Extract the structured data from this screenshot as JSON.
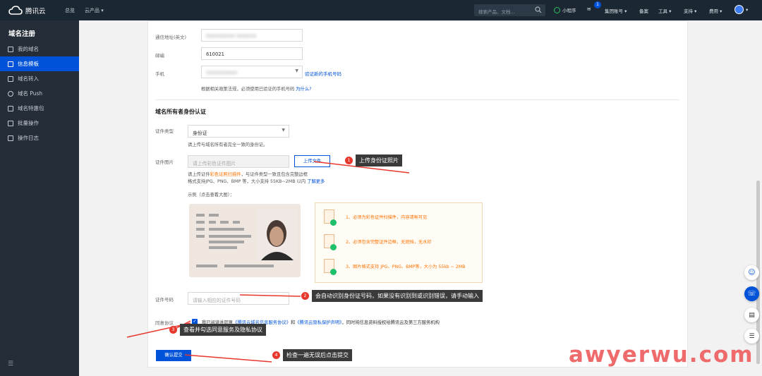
{
  "topbar": {
    "brand": "腾讯云",
    "nav_overview": "总览",
    "nav_products": "云产品",
    "search_placeholder": "搜索产品、文档...",
    "mini_program": "小程序",
    "message_badge": "1",
    "group_account": "集团账号",
    "filing": "备案",
    "tools": "工具",
    "support": "支持",
    "billing": "费用"
  },
  "sidebar": {
    "title": "域名注册",
    "items": [
      {
        "label": "我的域名"
      },
      {
        "label": "信息模板"
      },
      {
        "label": "域名转入"
      },
      {
        "label": "域名 Push"
      },
      {
        "label": "域名特惠包"
      },
      {
        "label": "批量操作"
      },
      {
        "label": "操作日志"
      }
    ]
  },
  "form": {
    "address_en_label": "通信地址(英文)",
    "address_en_value": "Xxxxxxxxxx xxxxxxx",
    "postcode_label": "邮编",
    "postcode_value": "610021",
    "phone_label": "手机",
    "phone_value": "1xxxxxxxxxx",
    "verify_phone_link": "验证新的手机号码",
    "phone_note": "根据相关政策法规，必须使用已验证的手机号码",
    "why_link": "为什么?",
    "section_title": "域名所有者身份认证",
    "id_type_label": "证件类型",
    "id_type_value": "身份证",
    "id_type_note": "请上传与域名所有者完全一致的身份证。",
    "id_photo_label": "证件图片",
    "id_photo_placeholder": "请上传彩色证件图片",
    "upload_button": "上传文件",
    "upload_note_1a": "请上传证件",
    "upload_note_1b": "彩色证照扫描件",
    "upload_note_1c": "，与证件类型一致且包含完整边框",
    "upload_note_2": "格式支持JPG、PNG、BMP 等，大小支持 55KB~2MB 以内",
    "learn_more": "了解更多",
    "example_label": "示例（点击查看大图）：",
    "requirements": [
      "1、必须为彩色证件扫描件，内容清晰可见",
      "2、必须包含完整证件边框，无遮挡，无水印",
      "3、图片格式支持 JPG、PNG、BMP等，大小为 55kb ~ 2MB"
    ],
    "id_number_label": "证件号码",
    "id_number_placeholder": "请输入相应的证件号码",
    "agreement_label": "同意协议",
    "agreement_text_a": "我已阅读并同意",
    "agreement_link_1": "《腾讯云域名信息服务协议》",
    "agreement_and": "和",
    "agreement_link_2": "《腾讯云隐私保护声明》",
    "agreement_text_b": "，同时将信息资料授权给腾讯云及第三方服务机构",
    "submit_button": "确认提交"
  },
  "callouts": [
    {
      "num": "1",
      "text": "上传身份证照片"
    },
    {
      "num": "2",
      "text": "会自动识别身份证号码，如果没有识别到或识别错误，请手动输入"
    },
    {
      "num": "3",
      "text": "查看并勾选同意服务及隐私协议"
    },
    {
      "num": "4",
      "text": "检查一遍无误后点击提交"
    }
  ],
  "watermark": "awyerwu.com",
  "colors": {
    "primary": "#0052d9",
    "topbar_bg": "#1b2733",
    "sidebar_bg": "#252e38",
    "accent_orange": "#ff7200",
    "callout_red": "#e8372c"
  }
}
